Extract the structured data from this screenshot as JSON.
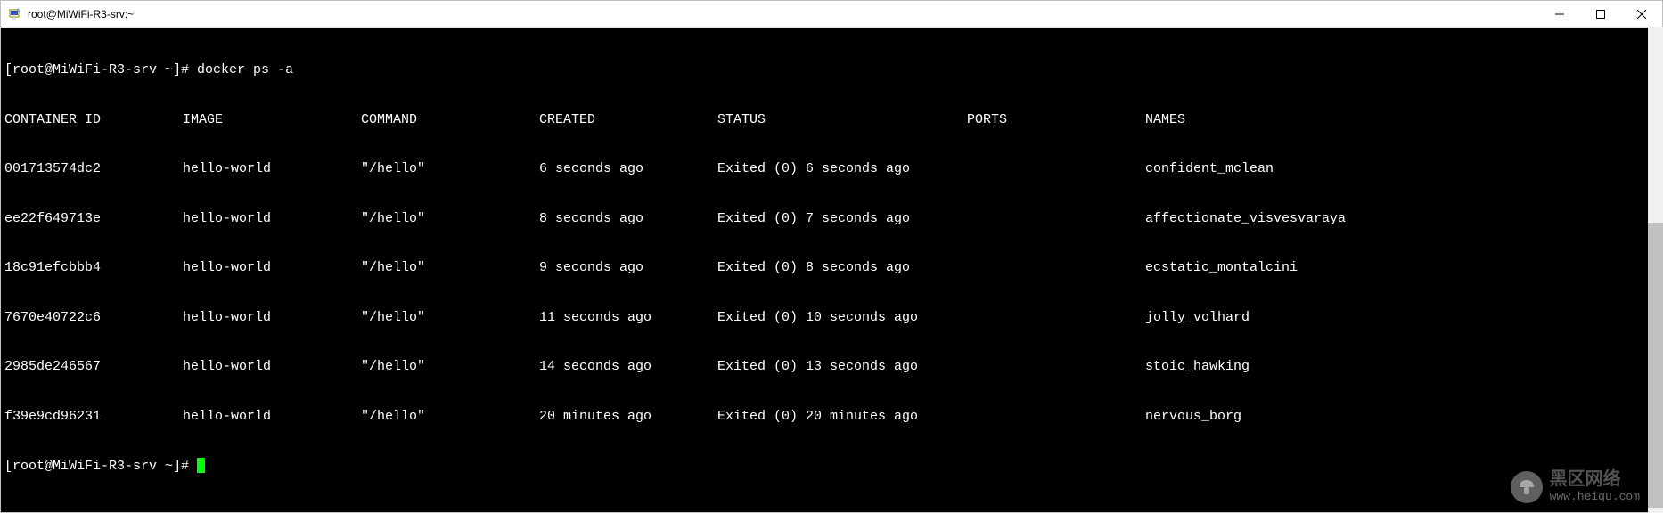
{
  "window": {
    "title": "root@MiWiFi-R3-srv:~"
  },
  "prompt": "[root@MiWiFi-R3-srv ~]# ",
  "command": "docker ps -a",
  "headers": {
    "container_id": "CONTAINER ID",
    "image": "IMAGE",
    "command": "COMMAND",
    "created": "CREATED",
    "status": "STATUS",
    "ports": "PORTS",
    "names": "NAMES"
  },
  "rows": [
    {
      "id": "001713574dc2",
      "image": "hello-world",
      "command": "\"/hello\"",
      "created": "6 seconds ago",
      "status": "Exited (0) 6 seconds ago",
      "ports": "",
      "names": "confident_mclean"
    },
    {
      "id": "ee22f649713e",
      "image": "hello-world",
      "command": "\"/hello\"",
      "created": "8 seconds ago",
      "status": "Exited (0) 7 seconds ago",
      "ports": "",
      "names": "affectionate_visvesvaraya"
    },
    {
      "id": "18c91efcbbb4",
      "image": "hello-world",
      "command": "\"/hello\"",
      "created": "9 seconds ago",
      "status": "Exited (0) 8 seconds ago",
      "ports": "",
      "names": "ecstatic_montalcini"
    },
    {
      "id": "7670e40722c6",
      "image": "hello-world",
      "command": "\"/hello\"",
      "created": "11 seconds ago",
      "status": "Exited (0) 10 seconds ago",
      "ports": "",
      "names": "jolly_volhard"
    },
    {
      "id": "2985de246567",
      "image": "hello-world",
      "command": "\"/hello\"",
      "created": "14 seconds ago",
      "status": "Exited (0) 13 seconds ago",
      "ports": "",
      "names": "stoic_hawking"
    },
    {
      "id": "f39e9cd96231",
      "image": "hello-world",
      "command": "\"/hello\"",
      "created": "20 minutes ago",
      "status": "Exited (0) 20 minutes ago",
      "ports": "",
      "names": "nervous_borg"
    }
  ],
  "watermark": {
    "cn": "黑区网络",
    "url": "www.heiqu.com"
  }
}
